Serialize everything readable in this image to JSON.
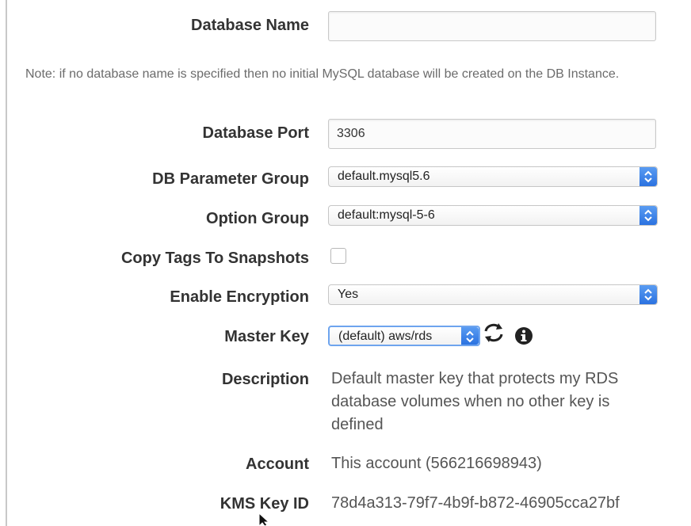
{
  "fields": {
    "database_name": {
      "label": "Database Name",
      "value": "",
      "placeholder": ""
    },
    "note": "Note: if no database name is specified then no initial MySQL database will be created on the DB Instance.",
    "database_port": {
      "label": "Database Port",
      "value": "3306"
    },
    "db_parameter_group": {
      "label": "DB Parameter Group",
      "selected": "default.mysql5.6"
    },
    "option_group": {
      "label": "Option Group",
      "selected": "default:mysql-5-6"
    },
    "copy_tags": {
      "label": "Copy Tags To Snapshots",
      "checked": false
    },
    "enable_encryption": {
      "label": "Enable Encryption",
      "selected": "Yes"
    },
    "master_key": {
      "label": "Master Key",
      "selected": "(default) aws/rds"
    },
    "description": {
      "label": "Description",
      "value": "Default master key that protects my RDS database volumes when no other key is defined"
    },
    "account": {
      "label": "Account",
      "value": "This account (566216698943)"
    },
    "kms_key_id": {
      "label": "KMS Key ID",
      "value": "78d4a313-79f7-4b9f-b872-46905cca27bf"
    }
  },
  "icons": {
    "refresh": "refresh-icon",
    "info": "info-icon",
    "select_stepper": "up-down-chevron-icon",
    "cursor": "mouse-cursor-icon"
  },
  "colors": {
    "stepper_blue": "#2b72e0",
    "label_text": "#333333",
    "note_text": "#6b6b6b"
  }
}
